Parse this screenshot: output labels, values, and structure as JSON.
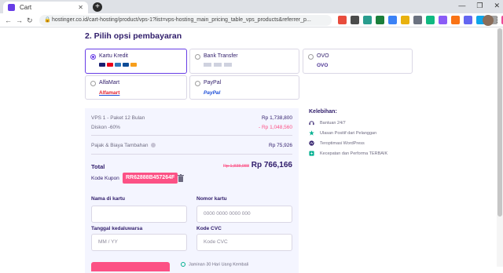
{
  "browser": {
    "tab_title": "Cart",
    "tab_close": "✕",
    "new_tab": "+",
    "url": "hostinger.co.id/cart-hosting/product/vps-1?list=vps-hosting_main_pricing_table_vps_products&referrer_p...",
    "window_controls": [
      "—",
      "❐",
      "✕"
    ]
  },
  "section_title": "2. Pilih opsi pembayaran",
  "payment_methods": [
    {
      "label": "Kartu Kredit",
      "selected": true
    },
    {
      "label": "Bank Transfer",
      "selected": false
    },
    {
      "label": "OVO",
      "logo": "OVO",
      "selected": false
    },
    {
      "label": "AlfaMart",
      "logo": "Alfamart",
      "selected": false
    },
    {
      "label": "PayPal",
      "logo": "PayPal",
      "selected": false
    }
  ],
  "summary": {
    "item_label": "VPS 1 - Paket 12 Bulan",
    "item_price": "Rp 1,738,800",
    "discount_label": "Diskon -60%",
    "discount_value": "- Rp 1,048,560",
    "tax_label": "Pajak & Biaya Tambahan",
    "tax_value": "Rp 75,926",
    "total_label": "Total",
    "total_old": "Rp 1,838,988",
    "total_new": "Rp 766,166",
    "coupon_label": "Kode Kupon",
    "coupon_code": "RR62888B457264F"
  },
  "form": {
    "name_label": "Nama di kartu",
    "name_placeholder": "",
    "card_label": "Nomor kartu",
    "card_placeholder": "0000 0000 0000 000",
    "expiry_label": "Tanggal kedaluwarsa",
    "expiry_placeholder": "MM / YY",
    "cvc_label": "Kode CVC",
    "cvc_placeholder": "Kode CVC"
  },
  "guarantee": "Jaminan 30 Hari Uang Kembali",
  "benefits": {
    "title": "Kelebihan:",
    "items": [
      "Bantuan 24/7",
      "Ulasan Positif dari Pelanggan",
      "Teroptimasi WordPress",
      "Kecepatan dan Performa TERBAIK"
    ]
  },
  "colors": {
    "accent": "#673de6",
    "pink": "#fc5185",
    "text": "#2f1c6a",
    "green": "#00b090"
  }
}
